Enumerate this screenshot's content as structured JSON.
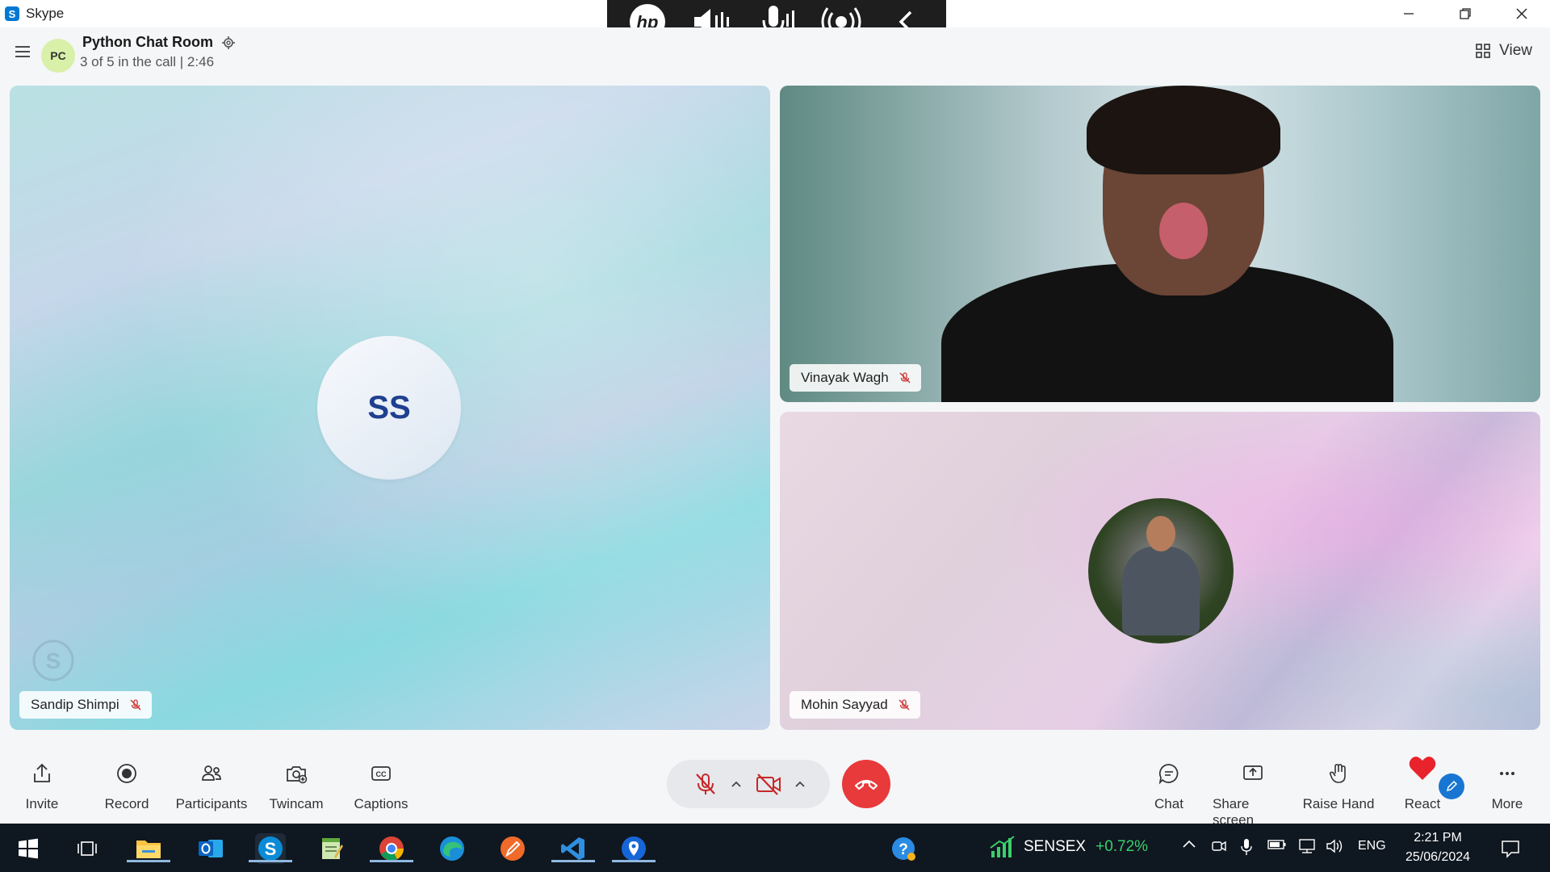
{
  "window": {
    "app_title": "Skype",
    "app_icon": "skype-logo",
    "controls": [
      "minimize-icon",
      "restore-icon",
      "close-icon"
    ]
  },
  "hp_toolbar": {
    "logo_text": "hp",
    "buttons": [
      "volume-icon",
      "microphone-icon",
      "broadcast-icon",
      "collapse-icon"
    ]
  },
  "header": {
    "avatar_initials": "PC",
    "room_title": "Python Chat Room",
    "call_status": "3 of 5 in the call | 2:46",
    "view_label": "View"
  },
  "tiles": {
    "left": {
      "initials": "SS",
      "name": "Sandip Shimpi"
    },
    "top_right": {
      "name": "Vinayak Wagh"
    },
    "bottom_right": {
      "name": "Mohin Sayyad"
    }
  },
  "toolbar": {
    "invite": "Invite",
    "record": "Record",
    "participants": "Participants",
    "twincam": "Twincam",
    "captions": "Captions",
    "chat": "Chat",
    "share_screen": "Share screen",
    "raise_hand": "Raise Hand",
    "react": "React",
    "more": "More"
  },
  "taskbar": {
    "apps": [
      "windows-start",
      "task-view",
      "file-explorer",
      "outlook",
      "skype",
      "notepad",
      "chrome",
      "edge",
      "pen-app",
      "vscode",
      "maps"
    ],
    "sensex_label": "SENSEX",
    "sensex_change": "+0.72%",
    "language": "ENG",
    "time": "2:21 PM",
    "date": "25/06/2024"
  },
  "colors": {
    "accent": "#0078d4",
    "end_call": "#e8393b",
    "sensex_up": "#3ad06b",
    "react_heart": "#e8232b"
  }
}
